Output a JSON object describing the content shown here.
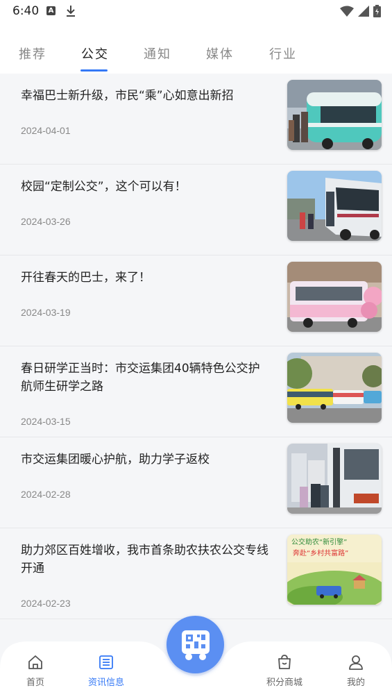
{
  "status_bar": {
    "time": "6:40",
    "a_badge": "A",
    "icons": [
      "download-icon",
      "wifi-icon",
      "signal-icon",
      "battery-icon"
    ]
  },
  "tabs": [
    {
      "label": "推荐",
      "active": false
    },
    {
      "label": "公交",
      "active": true
    },
    {
      "label": "通知",
      "active": false
    },
    {
      "label": "媒体",
      "active": false
    },
    {
      "label": "行业",
      "active": false
    }
  ],
  "news": [
    {
      "title": "幸福巴士新升级，市民“乘”心如意出新招",
      "date": "2024-04-01"
    },
    {
      "title": "校园“定制公交”，这个可以有！",
      "date": "2024-03-26"
    },
    {
      "title": "开往春天的巴士，来了！",
      "date": "2024-03-19"
    },
    {
      "title": "春日研学正当时：市交运集团40辆特色公交护航师生研学之路",
      "date": "2024-03-15"
    },
    {
      "title": "市交运集团暖心护航，助力学子返校",
      "date": "2024-02-28"
    },
    {
      "title": "助力郊区百姓增收，我市首条助农扶农公交专线开通",
      "date": "2024-02-23"
    }
  ],
  "poster_text": {
    "line1": "公交助农“新引擎”",
    "line2": "奔赴“乡村共富路”"
  },
  "bottom_nav": {
    "home": "首页",
    "news": "资讯信息",
    "mall": "积分商城",
    "mine": "我的"
  },
  "colors": {
    "accent": "#3478f6",
    "center_button": "#5b8ff2"
  }
}
